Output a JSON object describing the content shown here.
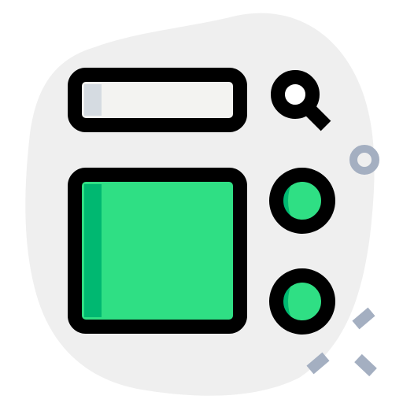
{
  "icon": {
    "name": "search-layout-icon",
    "colors": {
      "blob_bg": "#efefef",
      "outline": "#000000",
      "search_bar_fill": "#f3f3f1",
      "search_bar_shade": "#d5dbe1",
      "panel_fill": "#2fdf84",
      "panel_shade": "#00b871",
      "decor": "#a4afc1"
    }
  }
}
